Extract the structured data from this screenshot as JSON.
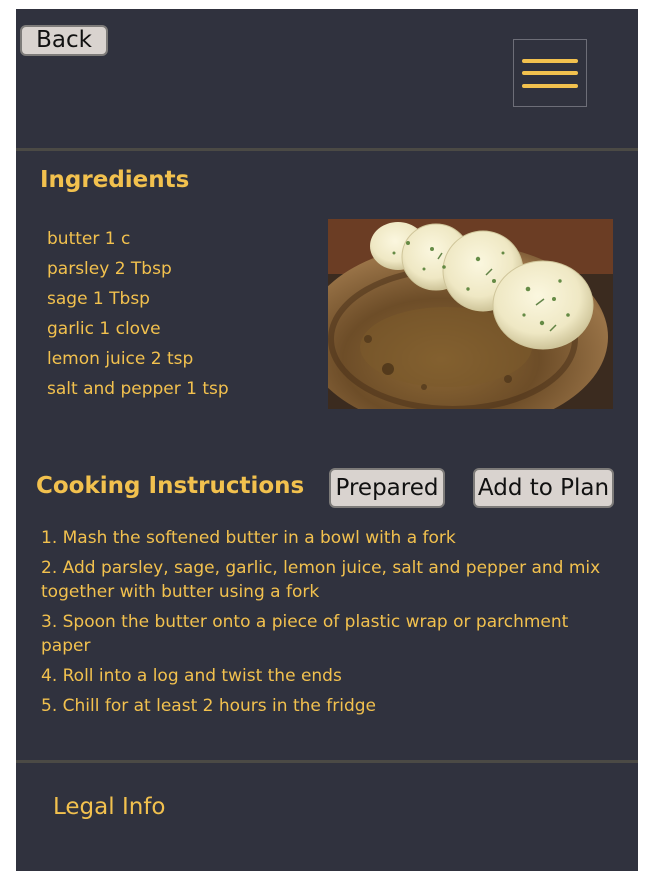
{
  "header": {
    "back_label": "Back",
    "menu_icon": "hamburger-menu-icon"
  },
  "ingredients": {
    "title": "Ingredients",
    "items": [
      "butter 1 c",
      "parsley 2 Tbsp",
      "sage 1 Tbsp",
      "garlic 1 clove",
      "lemon juice 2 tsp",
      "salt and pepper 1 tsp"
    ]
  },
  "cooking": {
    "title": "Cooking Instructions",
    "prepared_label": "Prepared",
    "add_to_plan_label": "Add to Plan",
    "steps": [
      "1. Mash the softened butter in a bowl with a fork",
      "2. Add parsley, sage, garlic, lemon juice, salt and pepper and mix together with butter using a fork",
      "3. Spoon the butter onto a piece of plastic wrap or parchment paper",
      "4. Roll into a log and twist the ends",
      "5. Chill for at least 2 hours in the fridge"
    ]
  },
  "footer": {
    "legal_label": "Legal Info"
  },
  "colors": {
    "background": "#30323e",
    "accent": "#f2c14e",
    "button": "#d9d3cf",
    "divider": "#4b4a45"
  }
}
